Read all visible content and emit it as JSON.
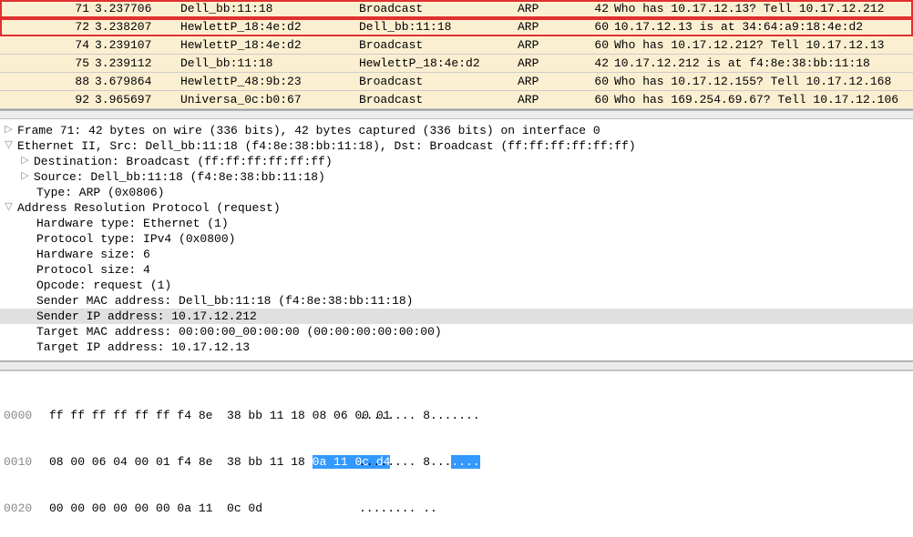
{
  "packets": [
    {
      "no": "71",
      "time": "3.237706",
      "src": "Dell_bb:11:18",
      "dst": "Broadcast",
      "proto": "ARP",
      "len": "42",
      "info": "Who has 10.17.12.13? Tell 10.17.12.212",
      "hl": true
    },
    {
      "no": "72",
      "time": "3.238207",
      "src": "HewlettP_18:4e:d2",
      "dst": "Dell_bb:11:18",
      "proto": "ARP",
      "len": "60",
      "info": "10.17.12.13 is at 34:64:a9:18:4e:d2",
      "hl": true
    },
    {
      "no": "74",
      "time": "3.239107",
      "src": "HewlettP_18:4e:d2",
      "dst": "Broadcast",
      "proto": "ARP",
      "len": "60",
      "info": "Who has 10.17.12.212? Tell 10.17.12.13",
      "hl": false
    },
    {
      "no": "75",
      "time": "3.239112",
      "src": "Dell_bb:11:18",
      "dst": "HewlettP_18:4e:d2",
      "proto": "ARP",
      "len": "42",
      "info": "10.17.12.212 is at f4:8e:38:bb:11:18",
      "hl": false
    },
    {
      "no": "88",
      "time": "3.679864",
      "src": "HewlettP_48:9b:23",
      "dst": "Broadcast",
      "proto": "ARP",
      "len": "60",
      "info": "Who has 10.17.12.155? Tell 10.17.12.168",
      "hl": false
    },
    {
      "no": "92",
      "time": "3.965697",
      "src": "Universa_0c:b0:67",
      "dst": "Broadcast",
      "proto": "ARP",
      "len": "60",
      "info": "Who has 169.254.69.67? Tell 10.17.12.106",
      "hl": false
    }
  ],
  "details": {
    "frame": "Frame 71: 42 bytes on wire (336 bits), 42 bytes captured (336 bits) on interface 0",
    "eth": "Ethernet II, Src: Dell_bb:11:18 (f4:8e:38:bb:11:18), Dst: Broadcast (ff:ff:ff:ff:ff:ff)",
    "eth_dst": "Destination: Broadcast (ff:ff:ff:ff:ff:ff)",
    "eth_src": "Source: Dell_bb:11:18 (f4:8e:38:bb:11:18)",
    "eth_type": "Type: ARP (0x0806)",
    "arp": "Address Resolution Protocol (request)",
    "arp_hw": "Hardware type: Ethernet (1)",
    "arp_proto": "Protocol type: IPv4 (0x0800)",
    "arp_hwsize": "Hardware size: 6",
    "arp_protosize": "Protocol size: 4",
    "arp_opcode": "Opcode: request (1)",
    "arp_sender_mac": "Sender MAC address: Dell_bb:11:18 (f4:8e:38:bb:11:18)",
    "arp_sender_ip": "Sender IP address: 10.17.12.212",
    "arp_target_mac": "Target MAC address: 00:00:00_00:00:00 (00:00:00:00:00:00)",
    "arp_target_ip": "Target IP address: 10.17.12.13"
  },
  "hex": {
    "rows": [
      {
        "offset": "0000",
        "b1": "ff ff ff ff ff ff f4 8e  38 bb 11 18 08 06 00 01",
        "ascii": "........ 8......."
      },
      {
        "offset": "0010",
        "b1": "08 00 06 04 00 01 f4 8e  38 bb 11 18 ",
        "hlb": "0a 11 0c d4",
        "ascii": "........ 8...",
        "hlascii": "...."
      },
      {
        "offset": "0020",
        "b1": "00 00 00 00 00 00 0a 11  0c 0d",
        "ascii": "........ .."
      }
    ]
  }
}
